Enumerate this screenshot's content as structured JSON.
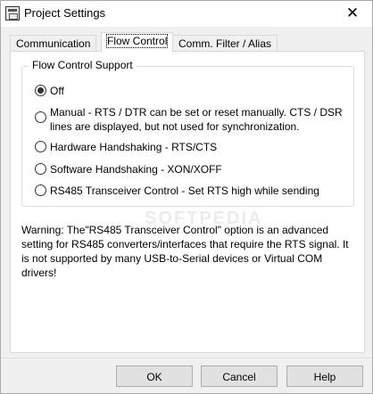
{
  "window": {
    "title": "Project Settings",
    "close_glyph": "✕",
    "icon": "app-icon"
  },
  "tabs": [
    {
      "label": "Communication",
      "active": false
    },
    {
      "label": "Flow Control",
      "active": true
    },
    {
      "label": "Comm. Filter / Alias",
      "active": false
    }
  ],
  "flow_control": {
    "group_title": "Flow Control Support",
    "options": [
      {
        "label": "Off",
        "checked": true
      },
      {
        "label": "Manual  -  RTS / DTR can be set or reset manually. CTS / DSR",
        "label_line2": "lines are displayed, but not used for synchronization.",
        "checked": false
      },
      {
        "label": "Hardware Handshaking - RTS/CTS",
        "checked": false
      },
      {
        "label": "Software Handshaking  -  XON/XOFF",
        "checked": false
      },
      {
        "label": "RS485 Transceiver Control - Set RTS high while sending",
        "checked": false
      }
    ]
  },
  "warning": {
    "line1": "Warning: The\"RS485 Transceiver Control\" option is an advanced",
    "line2": "setting for RS485 converters/interfaces that require the RTS signal. It",
    "line3": "is not supported by many USB-to-Serial devices or Virtual COM",
    "line4": "drivers!"
  },
  "buttons": {
    "ok": "OK",
    "cancel": "Cancel",
    "help": "Help"
  },
  "watermark": "SOFTPEDIA"
}
